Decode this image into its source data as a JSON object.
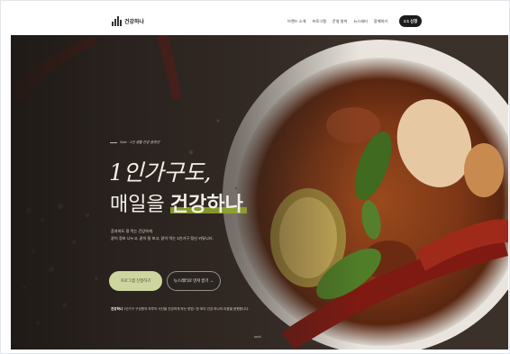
{
  "brand": {
    "name": "건강하나",
    "logo_icon": "bar-chart-logo-icon"
  },
  "nav": {
    "items": [
      "브랜드 소개",
      "프로그램",
      "운영 원칙",
      "뉴스레터",
      "함께하기"
    ],
    "cta": "1:1 신청"
  },
  "hero": {
    "eyebrow": "Solo · 1인 생활 건강 솔루션",
    "headline_line1": "1인가구도,",
    "headline_line2_prefix": "매일을 ",
    "headline_line2_highlight": "건강하나",
    "description_line1": "혼자여도 잘 먹는 건강하게.",
    "description_line2": "같이 정보 나누고, 같이 잘 보고, 같이 먹는 1인가구 정신 커뮤니티.",
    "primary_button": "프로그램 신청하기",
    "secondary_button": "뉴스레터로 먼저 받기 →",
    "footnote_brand": "건강하나",
    "footnote_text": "1인가구 구성원의 하루의 식단을 건강하게 하는 방법 / 한 뿌리 건강 하나의 이음을 응원합니다.",
    "scroll_hint": "scroll"
  },
  "colors": {
    "accent": "#8ea52b",
    "primary_button_bg": "#cfd5a0",
    "nav_cta_bg": "#1b1b1b",
    "hero_bg": "#2a2421"
  }
}
